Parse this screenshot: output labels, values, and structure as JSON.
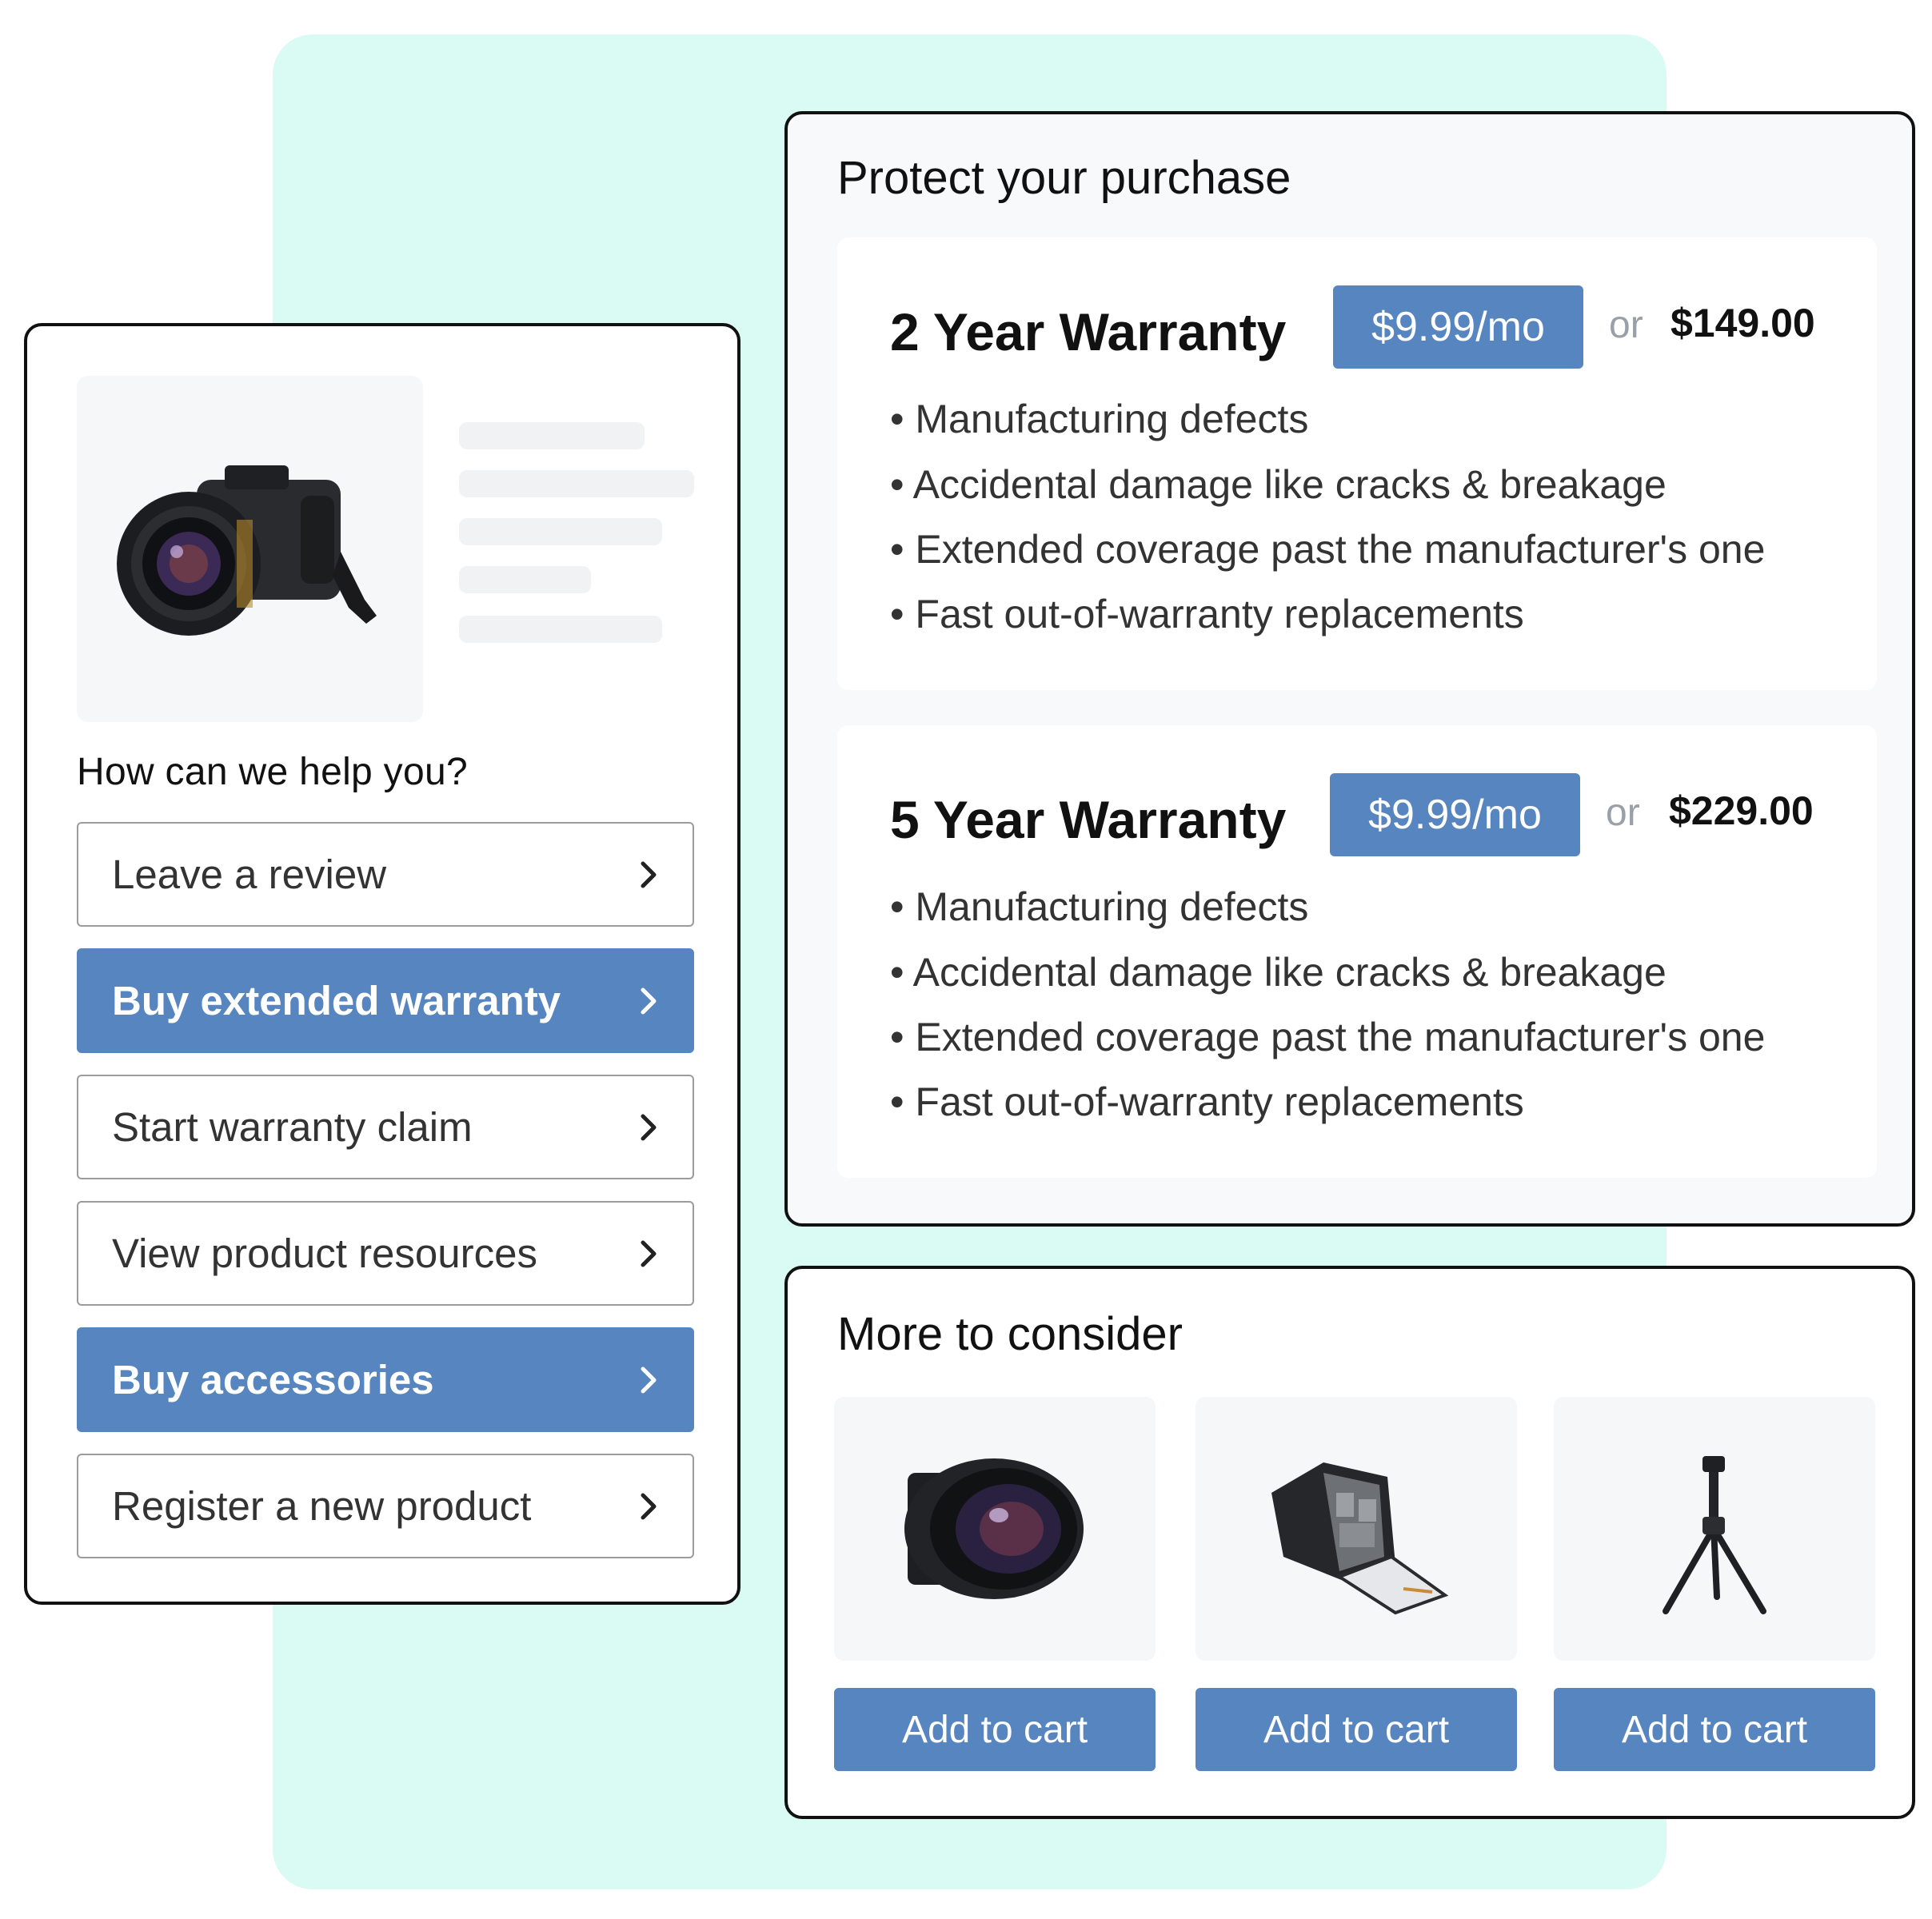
{
  "help": {
    "title": "How can we help you?",
    "options": [
      {
        "label": "Leave a review",
        "primary": false
      },
      {
        "label": "Buy extended warranty",
        "primary": true
      },
      {
        "label": "Start warranty claim",
        "primary": false
      },
      {
        "label": "View product resources",
        "primary": false
      },
      {
        "label": "Buy accessories",
        "primary": true
      },
      {
        "label": "Register a new product",
        "primary": false
      }
    ]
  },
  "warranty": {
    "title": "Protect your purchase",
    "plans": [
      {
        "name": "2 Year Warranty",
        "monthly": "$9.99/mo",
        "or": "or",
        "total": "$149.00",
        "features": [
          "• Manufacturing defects",
          "• Accidental damage like cracks & breakage",
          "• Extended coverage past the manufacturer's one",
          "• Fast out-of-warranty replacements"
        ]
      },
      {
        "name": "5 Year Warranty",
        "monthly": "$9.99/mo",
        "or": "or",
        "total": "$229.00",
        "features": [
          "• Manufacturing defects",
          "• Accidental damage like cracks & breakage",
          "• Extended coverage past the manufacturer's one",
          "• Fast out-of-warranty replacements"
        ]
      }
    ]
  },
  "consider": {
    "title": "More to consider",
    "products": [
      {
        "icon": "camera-lens-icon",
        "button": "Add to cart"
      },
      {
        "icon": "camera-backpack-icon",
        "button": "Add to cart"
      },
      {
        "icon": "tripod-icon",
        "button": "Add to cart"
      }
    ]
  },
  "colors": {
    "accent": "#5785c0",
    "background_panel": "#d9fbf3"
  }
}
